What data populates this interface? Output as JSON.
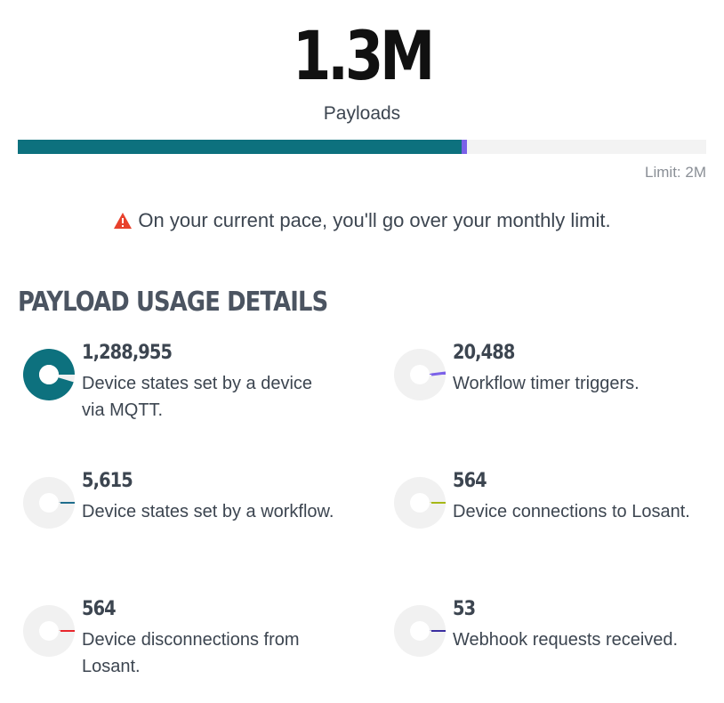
{
  "summary": {
    "total": "1.3M",
    "label": "Payloads",
    "limit_text": "Limit: 2M",
    "used_fraction": 0.645,
    "projected_fraction": 0.008,
    "used_color": "#0d717e",
    "projected_color": "#7b61e8"
  },
  "warning": {
    "icon": "warning-triangle-icon",
    "text": "On your current pace, you'll go over your monthly limit.",
    "icon_color": "#e8412c"
  },
  "section_title": "PAYLOAD USAGE DETAILS",
  "details": [
    {
      "value": "1,288,955",
      "description": "Device states set by a device via MQTT.",
      "fraction": 0.9532,
      "color": "#0d717e"
    },
    {
      "value": "20,488",
      "description": "Workflow timer triggers.",
      "fraction": 0.0152,
      "color": "#7b61e8"
    },
    {
      "value": "5,615",
      "description": "Device states set by a workflow.",
      "fraction": 0.0042,
      "color": "#1f6d8c"
    },
    {
      "value": "564",
      "description": "Device connections to Losant.",
      "fraction": 0.0004,
      "color": "#a6b816"
    },
    {
      "value": "564",
      "description": "Device disconnections from Losant.",
      "fraction": 0.0004,
      "color": "#e8262c"
    },
    {
      "value": "53",
      "description": "Webhook requests received.",
      "fraction": 4e-05,
      "color": "#3a2ea0"
    }
  ]
}
